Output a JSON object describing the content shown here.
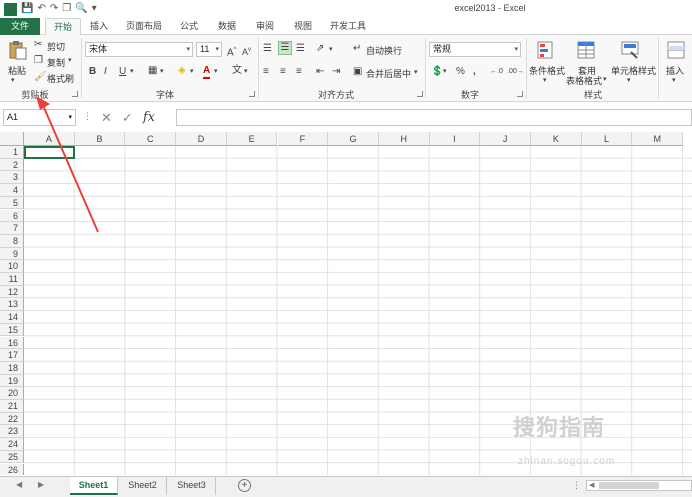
{
  "window": {
    "title": "excel2013 - Excel"
  },
  "tabs": [
    "文件",
    "开始",
    "插入",
    "页面布局",
    "公式",
    "数据",
    "审阅",
    "视图",
    "开发工具"
  ],
  "ribbon": {
    "clipboard": {
      "paste": "粘贴",
      "cut": "剪切",
      "copy": "复制",
      "format_painter": "格式刷",
      "label": "剪贴板"
    },
    "font": {
      "name": "宋体",
      "size": "11",
      "label": "字体",
      "bold": "B",
      "italic": "I",
      "underline": "U",
      "grow": "A",
      "shrink": "A",
      "font_color": "A"
    },
    "alignment": {
      "wrap": "自动换行",
      "merge": "合并后居中",
      "label": "对齐方式"
    },
    "number": {
      "format": "常规",
      "percent": "%",
      "comma": ",",
      "label": "数字"
    },
    "styles": {
      "conditional": "条件格式",
      "table_line1": "套用",
      "table_line2": "表格格式",
      "cell_styles": "单元格样式",
      "label": "样式"
    },
    "cells": {
      "insert": "插入"
    }
  },
  "formula_bar": {
    "name_box": "A1",
    "fx": "fx",
    "value": ""
  },
  "columns": [
    "A",
    "B",
    "C",
    "D",
    "E",
    "F",
    "G",
    "H",
    "I",
    "J",
    "K",
    "L",
    "M"
  ],
  "rows": [
    "1",
    "2",
    "3",
    "4",
    "5",
    "6",
    "7",
    "8",
    "9",
    "10",
    "11",
    "12",
    "13",
    "14",
    "15",
    "16",
    "17",
    "18",
    "19",
    "20",
    "21",
    "22",
    "23",
    "24",
    "25",
    "26"
  ],
  "sheets": [
    "Sheet1",
    "Sheet2",
    "Sheet3"
  ],
  "active_sheet": "Sheet1",
  "watermark": {
    "brand": "搜狗指南",
    "url": "zhinan.sogou.com"
  },
  "colors": {
    "accent": "#217346",
    "annotation": "#e8403a"
  }
}
